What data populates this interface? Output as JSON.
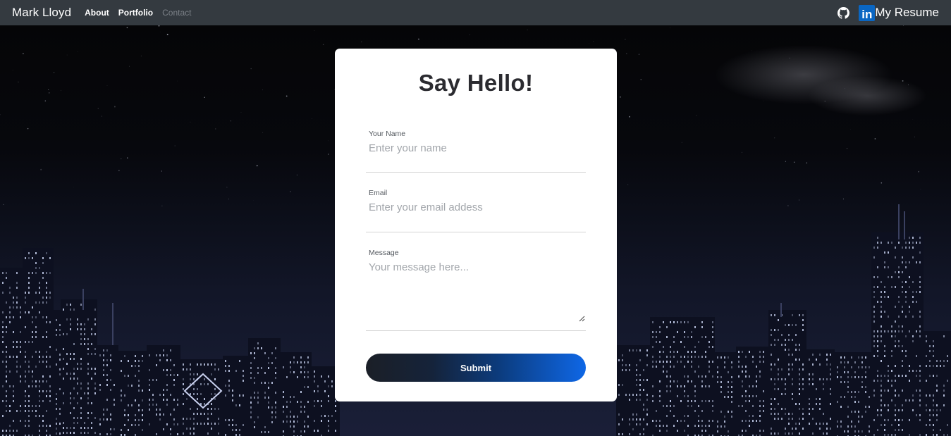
{
  "navbar": {
    "brand": "Mark Lloyd",
    "links": [
      {
        "label": "About"
      },
      {
        "label": "Portfolio"
      },
      {
        "label": "Contact"
      }
    ],
    "github_icon": "github-icon",
    "linkedin_icon": "linkedin-icon",
    "linkedin_glyph": "in",
    "resume_label": "My Resume"
  },
  "form": {
    "title": "Say Hello!",
    "name": {
      "label": "Your Name",
      "placeholder": "Enter your name",
      "value": ""
    },
    "email": {
      "label": "Email",
      "placeholder": "Enter your email addess",
      "value": ""
    },
    "message": {
      "label": "Message",
      "placeholder": "Your message here...",
      "value": ""
    },
    "submit_label": "Submit"
  },
  "colors": {
    "navbar_bg": "#343a40",
    "card_bg": "#ffffff",
    "button_gradient_start": "#1b1f27",
    "button_gradient_end": "#0e67e6",
    "linkedin_blue": "#0a66c2"
  }
}
